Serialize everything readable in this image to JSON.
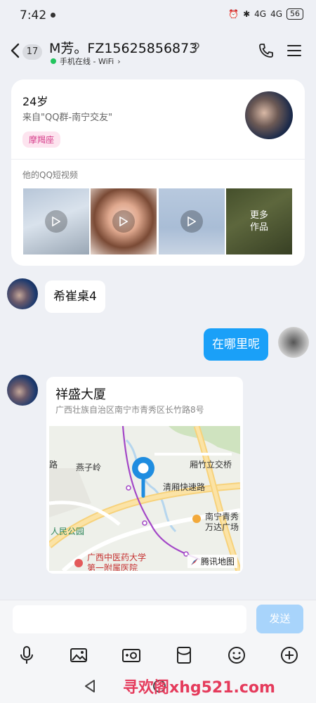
{
  "status": {
    "time": "7:42",
    "signal1": "4G",
    "signal2": "4G",
    "battery": "56"
  },
  "header": {
    "unread_count": "17",
    "contact_name": "M芳。FZ15625856873",
    "online_status": "手机在线 - WiFi"
  },
  "profile": {
    "age": "24岁",
    "from": "来自\"QQ群-南宁交友\"",
    "zodiac": "摩羯座",
    "videos_label": "他的QQ短视频",
    "more_line1": "更多",
    "more_line2": "作品"
  },
  "messages": [
    {
      "side": "left",
      "text": "希崔桌4"
    },
    {
      "side": "right",
      "text": "在哪里呢"
    }
  ],
  "location": {
    "title": "祥盛大厦",
    "address": "广西壮族自治区南宁市青秀区长竹路8号",
    "labels": {
      "yanziling": "燕子岭",
      "xiangzhu": "厢竹立交桥",
      "expressway": "清厢快速路",
      "park": "人民公园",
      "wanda1": "南宁青秀",
      "wanda2": "万达广场",
      "hospital1": "广西中医药大学",
      "hospital2": "第一附属医院",
      "road_edge": "路",
      "brand": "腾讯地图"
    }
  },
  "input": {
    "placeholder": "",
    "send_label": "发送"
  },
  "watermark": "寻欢阁xhg521.com",
  "colors": {
    "accent": "#1aa0f8",
    "send_disabled": "#a8d4fb",
    "online": "#22c55e",
    "zodiac": "#d6418c"
  }
}
